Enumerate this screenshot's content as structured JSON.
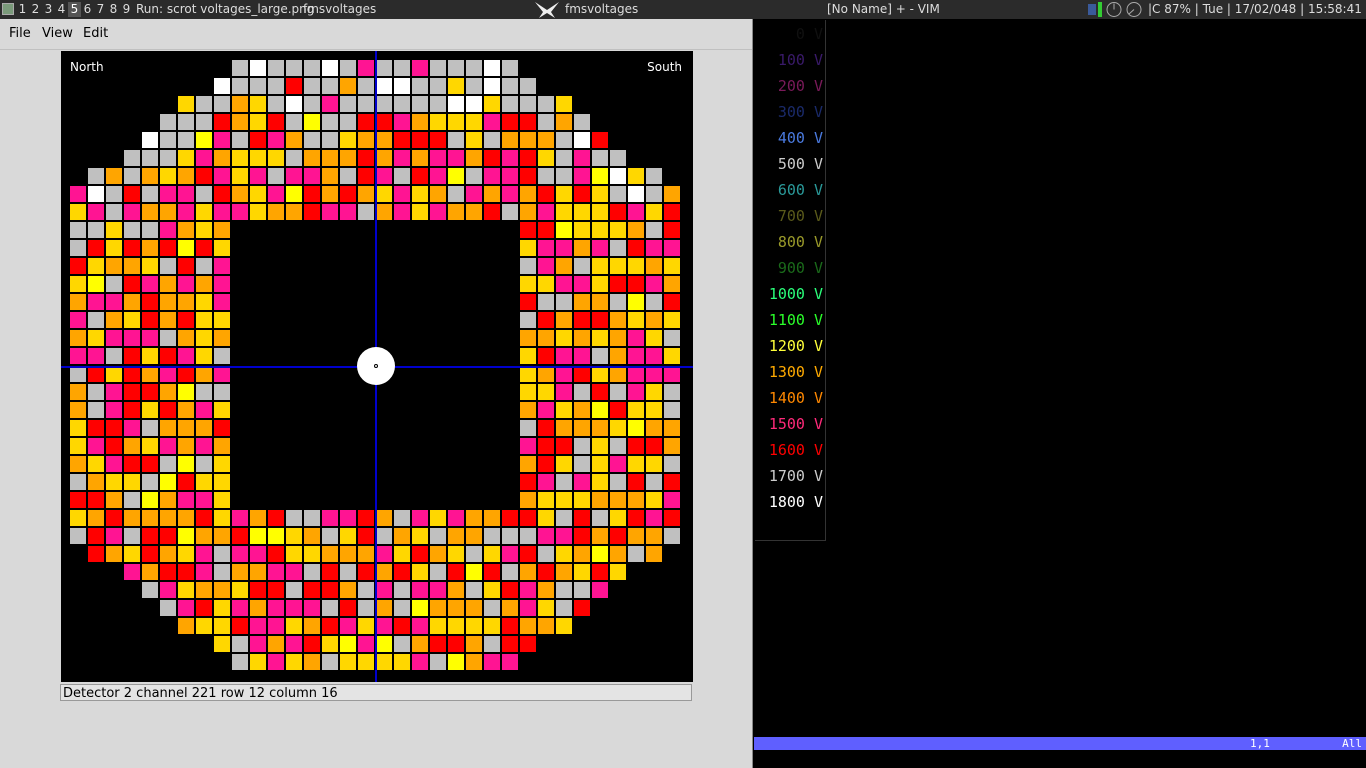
{
  "taskbar": {
    "workspaces": [
      "1",
      "2",
      "3",
      "4",
      "5",
      "6",
      "7",
      "8",
      "9"
    ],
    "current_workspace": "5",
    "run_title": "Run: scrot voltages_large.png",
    "app_title": "fmsvoltages",
    "center_title": "fmsvoltages",
    "vim_title": "[No Name] + - VIM",
    "status": "|C 87% | Tue | 17/02/048 | 15:58:41"
  },
  "menu": {
    "file": "File",
    "view": "View",
    "edit": "Edit"
  },
  "detector": {
    "north_label": "North",
    "south_label": "South"
  },
  "statusbar": "Detector 2 channel 221 row 12 column 16",
  "colors": {
    "gray": "#c0c0c0",
    "red": "#ff0000",
    "magenta": "#ff1493",
    "orange": "#ffa500",
    "gold": "#ffd700",
    "yellow": "#ffff00",
    "white": "#ffffff"
  },
  "legend": [
    {
      "label": "0 V",
      "color": "#101010"
    },
    {
      "label": "100 V",
      "color": "#3a1a6a"
    },
    {
      "label": "200 V",
      "color": "#7a1a5a"
    },
    {
      "label": "300 V",
      "color": "#1a2a6a"
    },
    {
      "label": "400 V",
      "color": "#4a7adf"
    },
    {
      "label": "500 V",
      "color": "#cccccc"
    },
    {
      "label": "600 V",
      "color": "#2a9a9a"
    },
    {
      "label": "700 V",
      "color": "#5a5a1a"
    },
    {
      "label": "800 V",
      "color": "#9a9a2a"
    },
    {
      "label": "900 V",
      "color": "#1a6a1a"
    },
    {
      "label": "1000 V",
      "color": "#2aff7a"
    },
    {
      "label": "1100 V",
      "color": "#2aff2a"
    },
    {
      "label": "1200 V",
      "color": "#ffff3a"
    },
    {
      "label": "1300 V",
      "color": "#ffaa00"
    },
    {
      "label": "1400 V",
      "color": "#ff8800"
    },
    {
      "label": "1500 V",
      "color": "#ff2a7a"
    },
    {
      "label": "1600 V",
      "color": "#ff0000"
    },
    {
      "label": "1700 V",
      "color": "#cccccc"
    },
    {
      "label": "1800 V",
      "color": "#ffffff"
    }
  ],
  "vim": {
    "position": "1,1",
    "scroll": "All"
  }
}
